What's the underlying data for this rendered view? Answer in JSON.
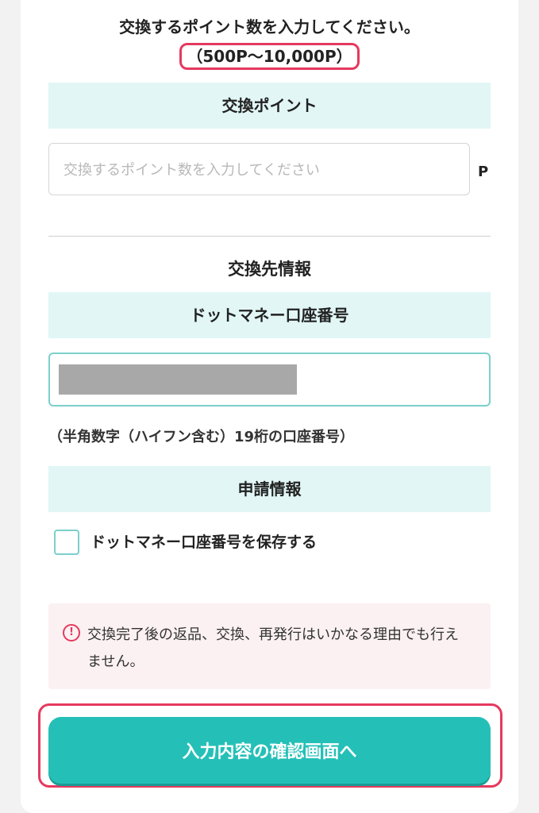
{
  "intro": {
    "instruction": "交換するポイント数を入力してください。",
    "range": "（500P〜10,000P）"
  },
  "points_section": {
    "title": "交換ポイント",
    "input_placeholder": "交換するポイント数を入力してください",
    "unit": "P"
  },
  "destination": {
    "heading": "交換先情報",
    "account_label": "ドットマネー口座番号",
    "account_hint": "（半角数字（ハイフン含む）19桁の口座番号）"
  },
  "application": {
    "title": "申請情報",
    "save_checkbox_label": "ドットマネー口座番号を保存する",
    "save_checked": false
  },
  "notice": {
    "icon": "exclamation-circle-icon",
    "text": "交換完了後の返品、交換、再発行はいかなる理由でも行えません。"
  },
  "submit": {
    "label": "入力内容の確認画面へ"
  },
  "colors": {
    "accent": "#24c0b7",
    "band": "#e2f6f6",
    "highlight": "#e6395e",
    "notice_bg": "#fbf1f2"
  }
}
